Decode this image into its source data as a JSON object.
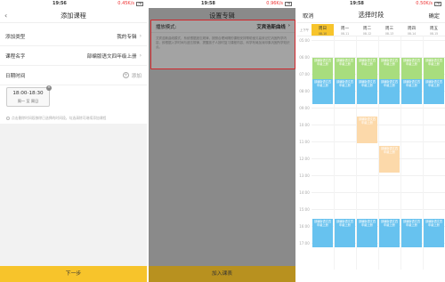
{
  "screen1": {
    "status": {
      "time": "19:56",
      "speed": "0.45K/s",
      "battery": "78"
    },
    "nav": {
      "title": "添加课程"
    },
    "rows": [
      {
        "label": "添加类型",
        "value": "我的专辑"
      },
      {
        "label": "课程名字",
        "value": "部编版语文四年级上册"
      },
      {
        "label": "日期时间",
        "value": "添加"
      }
    ],
    "time_card": {
      "time": "18:00-18:30",
      "days": "周一 至 周日"
    },
    "hint": "点击删除时间段移除已选择的时间段，勾选清除可继续添加课程",
    "bottom_button": "下一步"
  },
  "screen2": {
    "status": {
      "time": "19:58",
      "speed": "0.96K/s",
      "battery": "78"
    },
    "nav": {
      "title": "设置专辑"
    },
    "popup": {
      "label": "播放模式:",
      "value": "艾宾浩斯曲线",
      "desc": "艾宾浩斯曲线模式，系统根据遗忘规律，按照合理间隔的课程安排帮助宝贝高效记忆巩固所学内容，即根据入学时间与遗忘规律，提醒孩子人按时复习课程内容，科学布局加深印象巩固所学知识点。"
    },
    "bottom_button": "加入课表"
  },
  "screen3": {
    "status": {
      "time": "19:58",
      "speed": "0.50K/s",
      "battery": "78"
    },
    "nav": {
      "cancel": "取消",
      "title": "选择时段",
      "confirm": "确定"
    },
    "corner": "上下午",
    "days": [
      {
        "name": "周日",
        "date": "08-10"
      },
      {
        "name": "周一",
        "date": "08-11"
      },
      {
        "name": "周二",
        "date": "08-12"
      },
      {
        "name": "周三",
        "date": "08-13"
      },
      {
        "name": "周四",
        "date": "08-14"
      },
      {
        "name": "周五",
        "date": "08-15"
      }
    ],
    "hours": [
      "05:00",
      "06:00",
      "07:00",
      "08:00",
      "09:00",
      "10:00",
      "11:00",
      "12:00",
      "13:00",
      "14:00",
      "15:00",
      "16:00",
      "17:00"
    ],
    "block_text": "部编版语文四年级上册",
    "colors": {
      "accent": "#f7c42b",
      "green": "#a8dd7e",
      "blue": "#67c2ef",
      "orange": "#fcd9aa",
      "highlight": "#d0262b"
    }
  }
}
